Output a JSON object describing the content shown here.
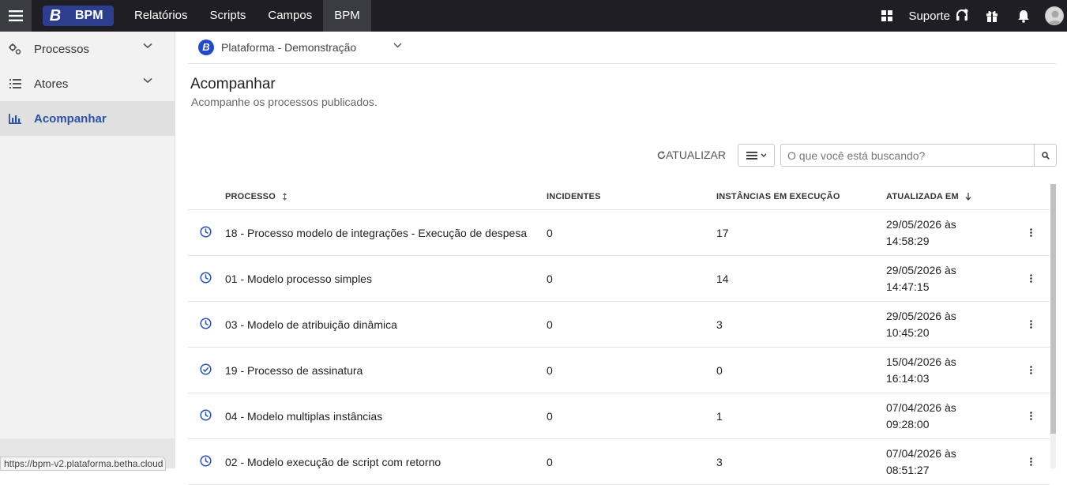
{
  "topbar": {
    "brand_logo": "B",
    "brand_name": "BPM",
    "nav": [
      {
        "label": "Relatórios"
      },
      {
        "label": "Scripts"
      },
      {
        "label": "Campos"
      },
      {
        "label": "BPM",
        "active": true
      }
    ],
    "support_label": "Suporte",
    "icons": [
      "apps-grid-icon",
      "headset-icon",
      "gift-icon",
      "bell-icon",
      "user-avatar"
    ]
  },
  "sidebar": {
    "items": [
      {
        "label": "Processos",
        "icon": "gears-icon",
        "expandable": true
      },
      {
        "label": "Atores",
        "icon": "list-icon",
        "expandable": true
      },
      {
        "label": "Acompanhar",
        "icon": "bar-chart-icon",
        "active": true
      }
    ]
  },
  "status_url": "https://bpm-v2.plataforma.betha.cloud",
  "main": {
    "selector": {
      "logo": "B",
      "label": "Plataforma - Demonstração"
    },
    "title": "Acompanhar",
    "subtitle": "Acompanhe os processos publicados.",
    "refresh_label": "ATUALIZAR",
    "search_placeholder": "O que você está buscando?",
    "columns": {
      "process": "PROCESSO",
      "incidents": "INCIDENTES",
      "instances": "INSTÂNCIAS EM EXECUÇÃO",
      "updated": "ATUALIZADA EM"
    },
    "rows": [
      {
        "status": "clock-icon",
        "name": "18 - Processo modelo de integrações - Execução de despesa",
        "incidents": "0",
        "instances": "17",
        "date": "29/05/2026 às",
        "time": "14:58:29"
      },
      {
        "status": "clock-icon",
        "name": "01 - Modelo processo simples",
        "incidents": "0",
        "instances": "14",
        "date": "29/05/2026 às",
        "time": "14:47:15"
      },
      {
        "status": "clock-icon",
        "name": "03 - Modelo de atribuição dinâmica",
        "incidents": "0",
        "instances": "3",
        "date": "29/05/2026 às",
        "time": "10:45:20"
      },
      {
        "status": "check-circle-icon",
        "name": "19 - Processo de assinatura",
        "incidents": "0",
        "instances": "0",
        "date": "15/04/2026 às",
        "time": "16:14:03"
      },
      {
        "status": "clock-icon",
        "name": "04 - Modelo multiplas instâncias",
        "incidents": "0",
        "instances": "1",
        "date": "07/04/2026 às",
        "time": "09:28:00"
      },
      {
        "status": "clock-icon",
        "name": "02 - Modelo execução de script com retorno",
        "incidents": "0",
        "instances": "3",
        "date": "07/04/2026 às",
        "time": "08:51:27"
      }
    ]
  },
  "colors": {
    "topbar_bg": "#1e1e24",
    "brand_bg": "#2d3e8e",
    "accent_blue": "#2a51a6",
    "sidebar_bg": "#f2f2f2"
  }
}
